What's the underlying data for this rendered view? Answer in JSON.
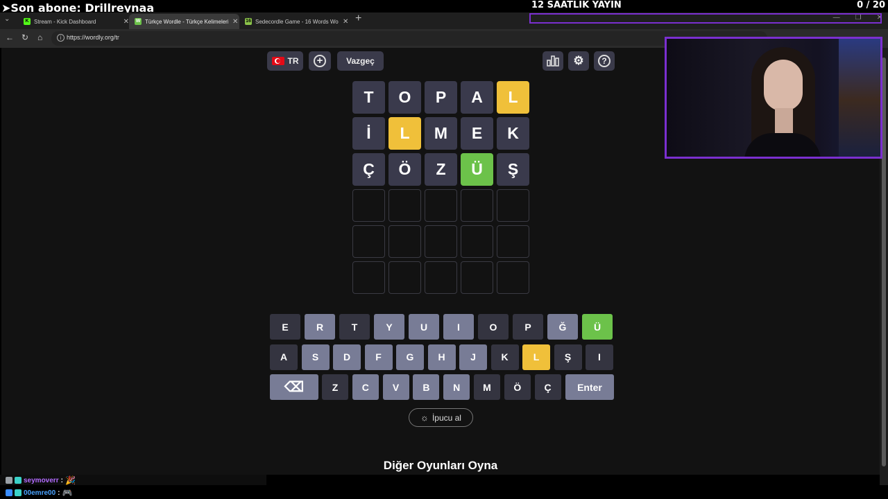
{
  "overlay": {
    "subscriber_text": "➤Son abone: Drillreynaa",
    "stream_title": "12 SAATLIK YAYIN",
    "counter": "0  / 20"
  },
  "browser": {
    "tabs": [
      {
        "title": "Stream - Kick Dashboard",
        "favicon": "K",
        "favicon_color": "#53fc18",
        "active": false
      },
      {
        "title": "Türkçe Wordle - Türkçe Kelimeleri",
        "favicon": "W",
        "favicon_color": "#6cc24a",
        "active": true
      },
      {
        "title": "Sedecordle Game - 16 Words Wor",
        "favicon": "16",
        "favicon_color": "#8bc34a",
        "active": false
      }
    ],
    "new_tab": "+",
    "url": "https://wordly.org/tr"
  },
  "header": {
    "lang_flag": "🇹🇷",
    "lang": "TR",
    "add_icon": "plus-circle-icon",
    "giveup": "Vazgeç",
    "icons": [
      "stats-icon",
      "gear-icon",
      "help-icon"
    ]
  },
  "board": [
    [
      {
        "l": "T",
        "s": "filled"
      },
      {
        "l": "O",
        "s": "filled"
      },
      {
        "l": "P",
        "s": "filled"
      },
      {
        "l": "A",
        "s": "filled"
      },
      {
        "l": "L",
        "s": "yellow"
      }
    ],
    [
      {
        "l": "İ",
        "s": "filled"
      },
      {
        "l": "L",
        "s": "yellow"
      },
      {
        "l": "M",
        "s": "filled"
      },
      {
        "l": "E",
        "s": "filled"
      },
      {
        "l": "K",
        "s": "filled"
      }
    ],
    [
      {
        "l": "Ç",
        "s": "filled"
      },
      {
        "l": "Ö",
        "s": "filled"
      },
      {
        "l": "Z",
        "s": "filled"
      },
      {
        "l": "Ü",
        "s": "green"
      },
      {
        "l": "Ş",
        "s": "filled"
      }
    ],
    [
      {
        "l": "",
        "s": "empty"
      },
      {
        "l": "",
        "s": "empty"
      },
      {
        "l": "",
        "s": "empty"
      },
      {
        "l": "",
        "s": "empty"
      },
      {
        "l": "",
        "s": "empty"
      }
    ],
    [
      {
        "l": "",
        "s": "empty"
      },
      {
        "l": "",
        "s": "empty"
      },
      {
        "l": "",
        "s": "empty"
      },
      {
        "l": "",
        "s": "empty"
      },
      {
        "l": "",
        "s": "empty"
      }
    ],
    [
      {
        "l": "",
        "s": "empty"
      },
      {
        "l": "",
        "s": "empty"
      },
      {
        "l": "",
        "s": "empty"
      },
      {
        "l": "",
        "s": "empty"
      },
      {
        "l": "",
        "s": "empty"
      }
    ]
  ],
  "keyboard": [
    [
      {
        "k": "E",
        "s": "plain"
      },
      {
        "k": "R",
        "s": "gray"
      },
      {
        "k": "T",
        "s": "plain"
      },
      {
        "k": "Y",
        "s": "gray"
      },
      {
        "k": "U",
        "s": "gray"
      },
      {
        "k": "I",
        "s": "gray"
      },
      {
        "k": "O",
        "s": "plain"
      },
      {
        "k": "P",
        "s": "plain"
      },
      {
        "k": "Ğ",
        "s": "gray"
      },
      {
        "k": "Ü",
        "s": "green"
      }
    ],
    [
      {
        "k": "A",
        "s": "plain"
      },
      {
        "k": "S",
        "s": "gray"
      },
      {
        "k": "D",
        "s": "gray"
      },
      {
        "k": "F",
        "s": "gray"
      },
      {
        "k": "G",
        "s": "gray"
      },
      {
        "k": "H",
        "s": "gray"
      },
      {
        "k": "J",
        "s": "gray"
      },
      {
        "k": "K",
        "s": "plain"
      },
      {
        "k": "L",
        "s": "yellow"
      },
      {
        "k": "Ş",
        "s": "plain"
      },
      {
        "k": "I",
        "s": "plain"
      }
    ],
    [
      {
        "k": "⌫",
        "s": "gray",
        "name": "backspace"
      },
      {
        "k": "Z",
        "s": "plain"
      },
      {
        "k": "C",
        "s": "gray"
      },
      {
        "k": "V",
        "s": "gray"
      },
      {
        "k": "B",
        "s": "gray"
      },
      {
        "k": "N",
        "s": "gray"
      },
      {
        "k": "M",
        "s": "plain"
      },
      {
        "k": "Ö",
        "s": "plain"
      },
      {
        "k": "Ç",
        "s": "plain"
      },
      {
        "k": "Enter",
        "s": "gray",
        "name": "enter"
      }
    ]
  ],
  "hint_button": "İpucu al",
  "other_games_heading": "Diğer Oyunları Oyna",
  "chat": [
    {
      "user": "seymoverr",
      "sep": ":",
      "color": "#b36cff"
    },
    {
      "user": "00emre00",
      "sep": ":",
      "color": "#4aa3ff"
    }
  ],
  "colors": {
    "accent_purple": "#7b2fd0",
    "tile_yellow": "#f0c03a",
    "tile_green": "#6cc24a",
    "tile_filled": "#3a3a4c",
    "key_gray": "#787c96",
    "key_plain": "#343440"
  }
}
